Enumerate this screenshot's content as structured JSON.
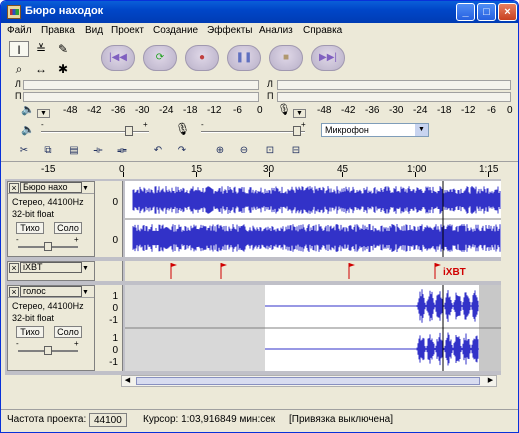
{
  "window": {
    "title": "Бюро находок"
  },
  "menu": [
    "Файл",
    "Правка",
    "Вид",
    "Проект",
    "Создание",
    "Эффекты",
    "Анализ",
    "Справка"
  ],
  "meters": {
    "play_channels": [
      "Л",
      "П"
    ],
    "rec_channels": [
      "Л",
      "П"
    ],
    "scale": [
      "-48",
      "-42",
      "-36",
      "-30",
      "-24",
      "-18",
      "-12",
      "-6",
      "0"
    ]
  },
  "mixer": {
    "input_source": "Микрофон",
    "slider_minus": "-",
    "slider_plus": "+"
  },
  "ruler": {
    "labels": [
      "-15",
      "0",
      "15",
      "30",
      "45",
      "1:00",
      "1:15"
    ]
  },
  "tracks": {
    "audio1": {
      "name": "Бюро нахо",
      "info1": "Стерео, 44100Hz",
      "info2": "32-bit float",
      "mute": "Тихо",
      "solo": "Соло",
      "scale_top": "0",
      "scale_bottom": "0",
      "pan_left": "-",
      "pan_right": "+"
    },
    "label": {
      "name": "iXBT",
      "label_text": "iXBT"
    },
    "audio2": {
      "name": "голос",
      "info1": "Стерео, 44100Hz",
      "info2": "32-bit float",
      "mute": "Тихо",
      "solo": "Соло",
      "scale": [
        "1",
        "0",
        "-1",
        "1",
        "0",
        "-1"
      ],
      "pan_left": "-",
      "pan_right": "+"
    }
  },
  "status": {
    "rate_label": "Частота проекта:",
    "rate_value": "44100",
    "cursor": "Курсор: 1:03,916849 мин:сек",
    "snap": "[Привязка выключена]"
  },
  "colors": {
    "waveform": "#3232c8",
    "label_flag": "#d00000",
    "titlebar": "#0046c8"
  }
}
